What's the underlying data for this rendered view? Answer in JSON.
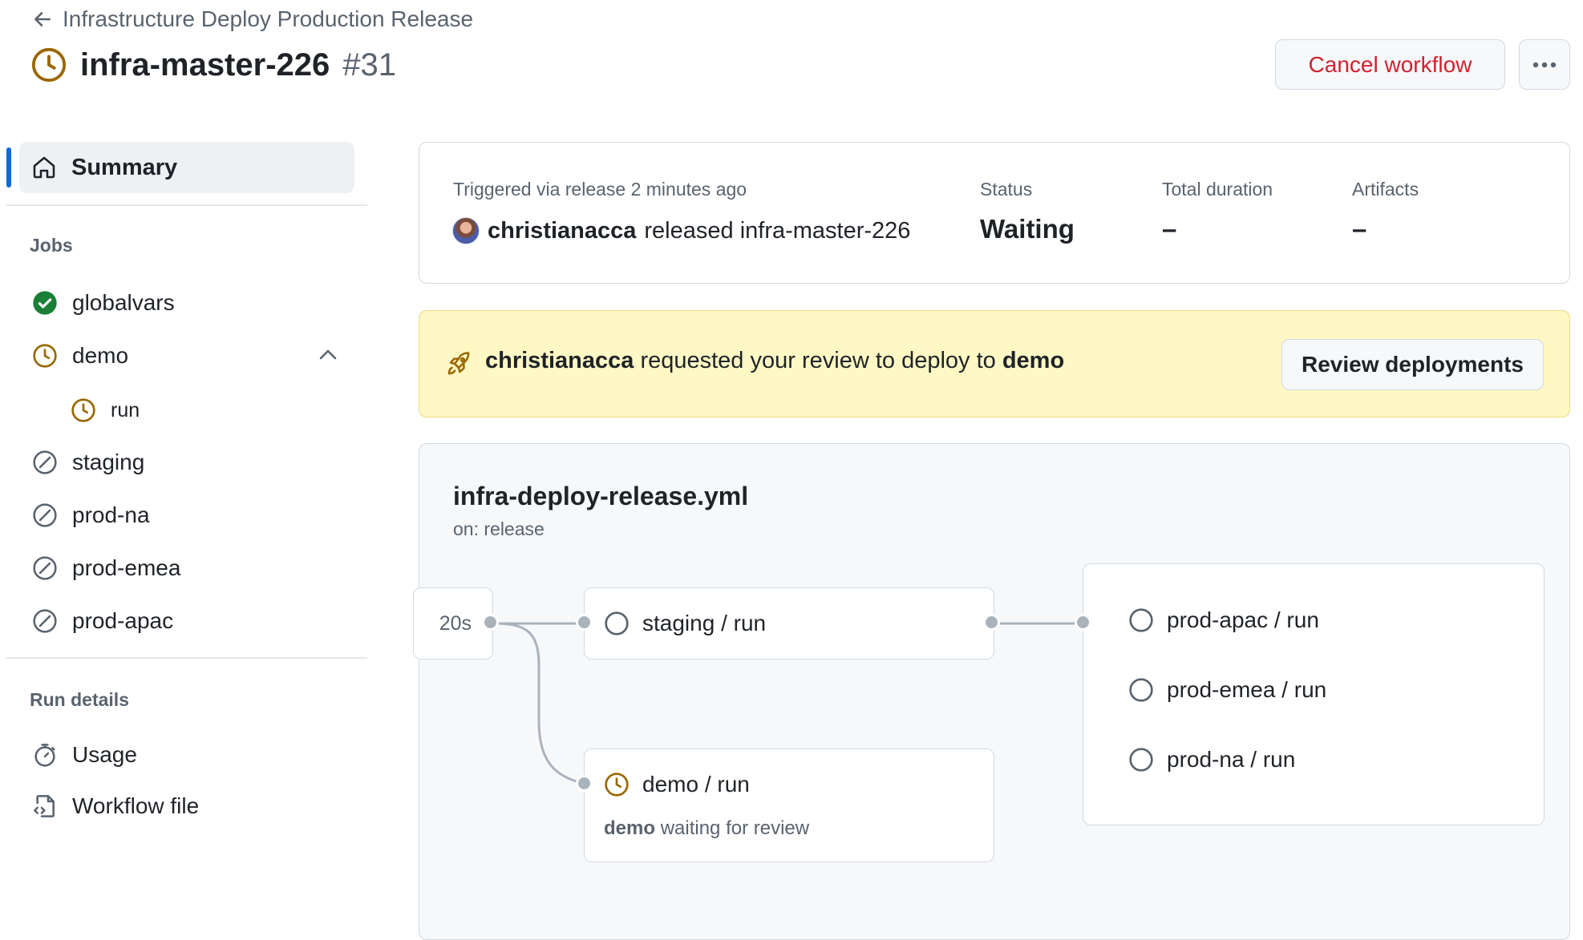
{
  "header": {
    "back_label": "Infrastructure Deploy Production Release",
    "title": "infra-master-226",
    "run_number": "#31",
    "cancel_label": "Cancel workflow"
  },
  "sidebar": {
    "summary_label": "Summary",
    "jobs_heading": "Jobs",
    "jobs": [
      {
        "label": "globalvars",
        "status": "success"
      },
      {
        "label": "demo",
        "status": "waiting",
        "expanded": true
      },
      {
        "label": "run",
        "status": "waiting"
      },
      {
        "label": "staging",
        "status": "skipped"
      },
      {
        "label": "prod-na",
        "status": "skipped"
      },
      {
        "label": "prod-emea",
        "status": "skipped"
      },
      {
        "label": "prod-apac",
        "status": "skipped"
      }
    ],
    "run_details_heading": "Run details",
    "usage_label": "Usage",
    "workflow_file_label": "Workflow file"
  },
  "summary": {
    "trigger_text": "Triggered via release 2 minutes ago",
    "user": "christianacca",
    "release_text": "released infra-master-226",
    "status_label": "Status",
    "status_value": "Waiting",
    "duration_label": "Total duration",
    "duration_value": "–",
    "artifacts_label": "Artifacts",
    "artifacts_value": "–"
  },
  "review_banner": {
    "user": "christianacca",
    "text": "requested your review to deploy to",
    "environment": "demo",
    "button_label": "Review deployments"
  },
  "graph": {
    "file_name": "infra-deploy-release.yml",
    "trigger": "on: release",
    "first_node_duration": "20s",
    "staging_label": "staging / run",
    "demo_label": "demo / run",
    "demo_env": "demo",
    "demo_status_text": "waiting for review",
    "prod_jobs": [
      "prod-apac / run",
      "prod-emea / run",
      "prod-na / run"
    ]
  },
  "colors": {
    "waiting": "#9a6700",
    "success": "#1a7f37",
    "danger": "#cf222e",
    "accent": "#0969da",
    "banner_bg": "#fff8c5"
  }
}
